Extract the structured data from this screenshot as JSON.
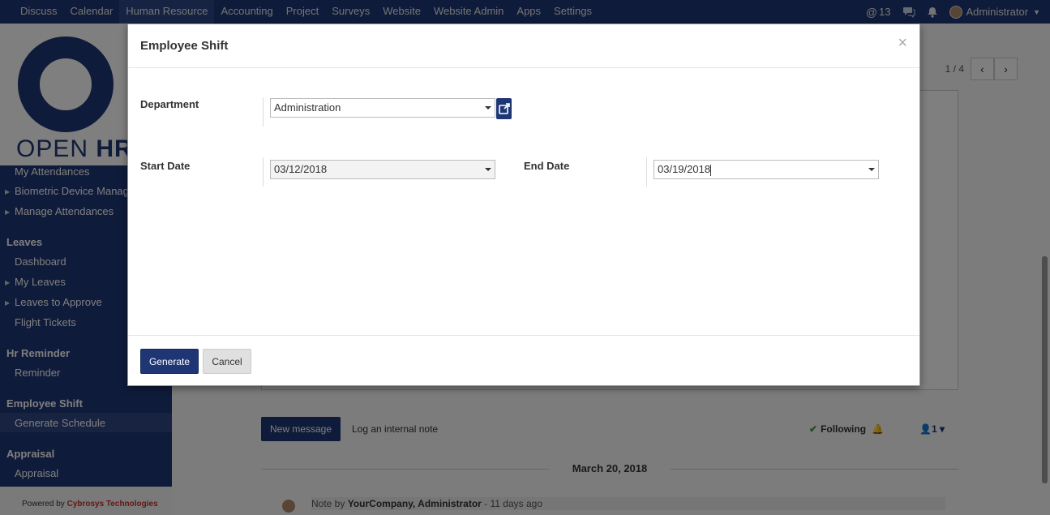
{
  "topnav": {
    "menu": [
      "Discuss",
      "Calendar",
      "Human Resource",
      "Accounting",
      "Project",
      "Surveys",
      "Website",
      "Website Admin",
      "Apps",
      "Settings"
    ],
    "active_index": 2,
    "mentions_count": "13",
    "user": "Administrator"
  },
  "sidebar": {
    "logo_text_light": "OPEN ",
    "logo_text_bold": "HRI",
    "attendance_items": [
      "My Attendances",
      "Biometric Device Manag",
      "Manage Attendances"
    ],
    "leaves_title": "Leaves",
    "leaves_items": [
      "Dashboard",
      "My Leaves",
      "Leaves to Approve",
      "Flight Tickets"
    ],
    "reminder_title": "Hr Reminder",
    "reminder_items": [
      "Reminder"
    ],
    "shift_title": "Employee Shift",
    "shift_items": [
      "Generate Schedule"
    ],
    "appraisal_title": "Appraisal",
    "appraisal_items": [
      "Appraisal"
    ],
    "powered_prefix": "Powered by ",
    "powered_brand": "Cybrosys Technologies"
  },
  "main": {
    "pager_text": "1 / 4",
    "chatter": {
      "new_message": "New message",
      "log_note": "Log an internal note",
      "following": "Following",
      "followers_count": "1",
      "date_separator": "March 20, 2018",
      "note_prefix": "Note by ",
      "note_author": "YourCompany, Administrator",
      "note_time": " - 11 days ago"
    }
  },
  "modal": {
    "title": "Employee Shift",
    "close": "×",
    "department_label": "Department",
    "department_value": "Administration",
    "start_date_label": "Start Date",
    "start_date_value": "03/12/2018",
    "end_date_label": "End Date",
    "end_date_value": "03/19/2018",
    "generate_label": "Generate",
    "cancel_label": "Cancel"
  }
}
